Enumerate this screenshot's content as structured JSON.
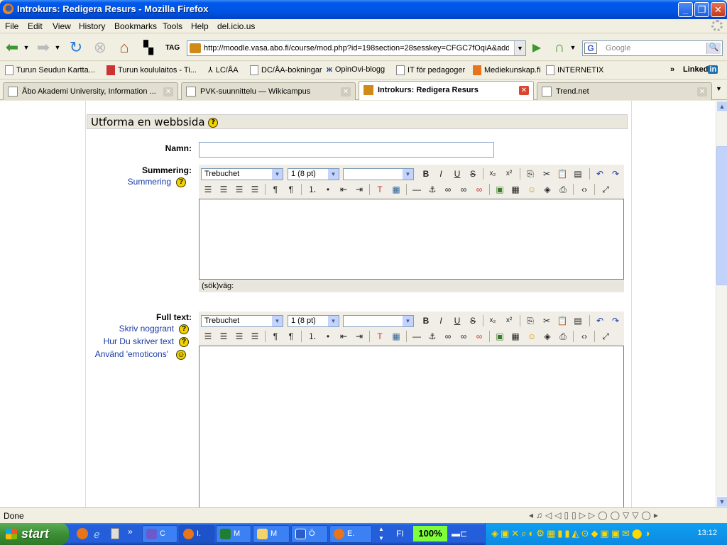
{
  "window": {
    "title": "Introkurs: Redigera Resurs - Mozilla Firefox"
  },
  "menu": [
    "File",
    "Edit",
    "View",
    "History",
    "Bookmarks",
    "Tools",
    "Help",
    "del.icio.us"
  ],
  "nav": {
    "url": "http://moodle.vasa.abo.fi/course/mod.php?id=198section=28sesskey=CFGC7fOqiA&add",
    "search_placeholder": "Google",
    "search_engine_letter": "G"
  },
  "bookmarks": [
    "Turun Seudun Kartta...",
    "Turun koululaitos - Ti...",
    "LC/ÅA",
    "DC/ÅA-bokningar",
    "OpinOvi-blogg",
    "IT för pedagoger",
    "Mediekunskap.fi",
    "INTERNETIX"
  ],
  "bookmarks_overflow": "»",
  "linkedin": "Linked",
  "linkedin_in": "in",
  "tabs": [
    {
      "label": "Åbo Akademi University, Information ...",
      "active": false
    },
    {
      "label": "PVK-suunnittelu — Wikicampus",
      "active": false
    },
    {
      "label": "Introkurs: Redigera Resurs",
      "active": true
    },
    {
      "label": "Trend.net",
      "active": false
    }
  ],
  "form": {
    "section_title": "Utforma en webbsida",
    "namn_label": "Namn:",
    "summering_label": "Summering:",
    "summering_help": "Summering",
    "fulltext_label": "Full text:",
    "fulltext_links": [
      "Skriv noggrant",
      "Hur Du skriver text",
      "Använd 'emoticons'"
    ],
    "font_name": "Trebuchet",
    "font_size": "1 (8 pt)",
    "format": "",
    "path_label": "(sök)väg:"
  },
  "status": {
    "text": "Done"
  },
  "taskbar": {
    "start": "start",
    "tasks": [
      "C",
      "I.",
      "M",
      "M",
      "Ö",
      "E."
    ],
    "lang": "FI",
    "zoom": "100%",
    "clock": "13:12"
  },
  "colors": {
    "titlebar": "#0054e3",
    "taskbar": "#245edb",
    "start": "#3c8f36",
    "link": "#1a3aa8",
    "help_icon": "#f3d200"
  }
}
